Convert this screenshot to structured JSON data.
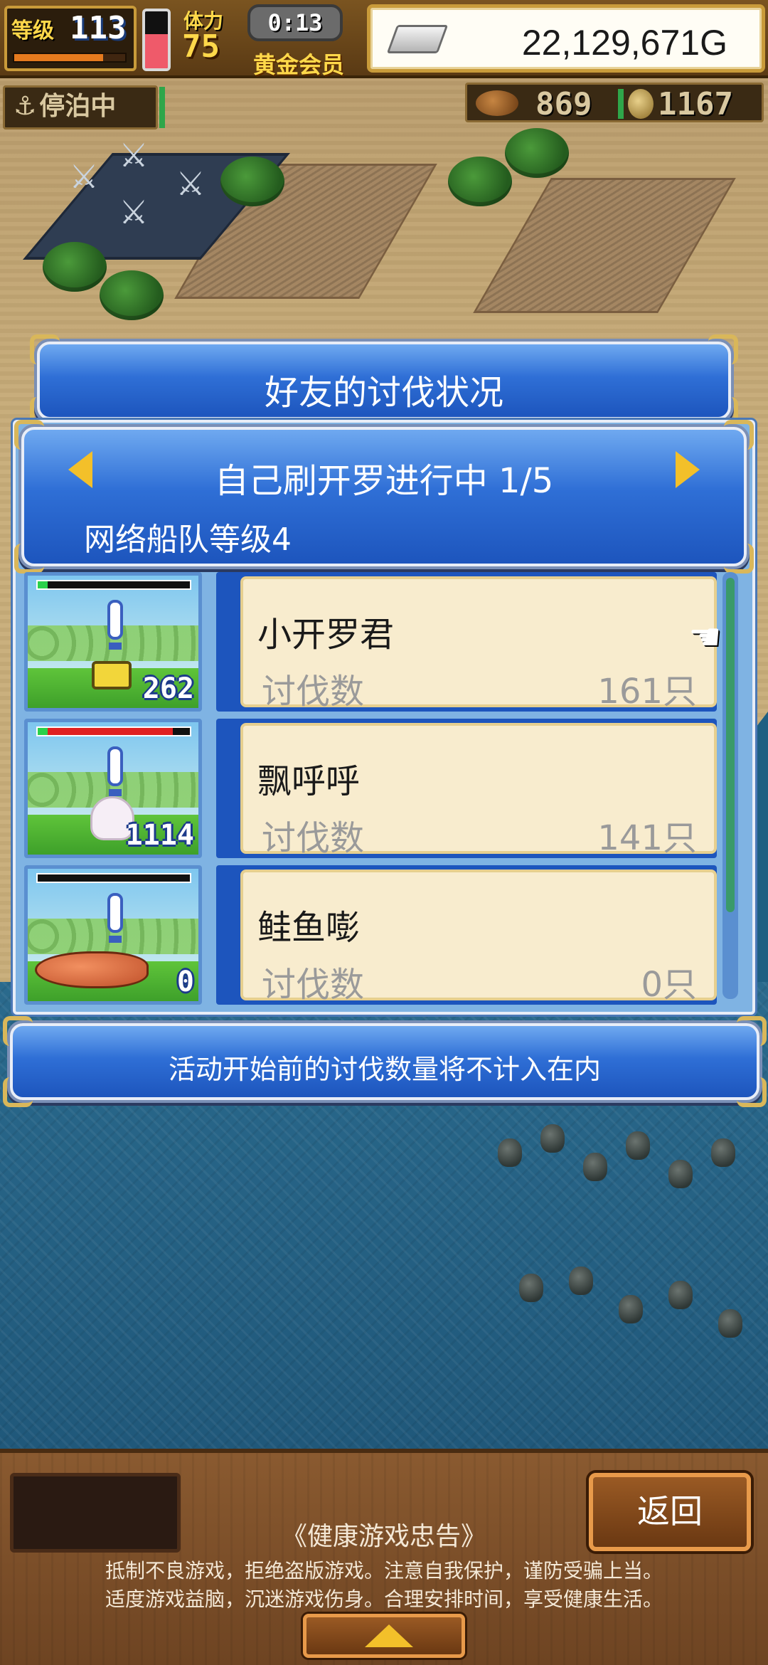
{
  "hud": {
    "level_label": "等级",
    "level_value": "113",
    "exp_fraction": 0.8,
    "stamina_label": "体力",
    "stamina_value": "75",
    "stamina_fraction": 0.6,
    "timer": "0:13",
    "membership": "黄金会员",
    "money": "22,129,671G",
    "moored_status": "停泊中",
    "resource_1": "869",
    "resource_2": "1167"
  },
  "dialog": {
    "title": "好友的讨伐状况",
    "header_line1": "自己刷开罗进行中 1/5",
    "header_line2": "网络船队等级4",
    "notice": "活动开始前的讨伐数量将不计入在内"
  },
  "rows": [
    {
      "name": "小开罗君",
      "label": "讨伐数",
      "value": "161只",
      "count": "262",
      "hp_fraction": 0.0,
      "hp_color": "#e02020"
    },
    {
      "name": "飘呼呼",
      "label": "讨伐数",
      "value": "141只",
      "count": "1114",
      "hp_fraction": 0.88,
      "hp_color": "#e02020"
    },
    {
      "name": "鲑鱼嘭",
      "label": "讨伐数",
      "value": "0只",
      "count": "0",
      "hp_fraction": 0.0,
      "hp_color": "#e02020"
    }
  ],
  "bottom": {
    "back_label": "返回",
    "advisory_title": "《健康游戏忠告》",
    "advisory_line1": "抵制不良游戏，拒绝盗版游戏。注意自我保护，谨防受骗上当。",
    "advisory_line2": "适度游戏益脑，沉迷游戏伤身。合理安排时间，享受健康生活。"
  },
  "icons": {
    "anchor": "anchor-icon",
    "silver": "silver-bar-icon",
    "meat": "meat-icon",
    "coin": "coin-icon",
    "pointer": "hand-pointer-icon"
  },
  "colors": {
    "banner_blue": "#2f6fd6",
    "card_bg": "#f8ecce",
    "gold": "#ffd84a",
    "arrow": "#f3c02a"
  }
}
